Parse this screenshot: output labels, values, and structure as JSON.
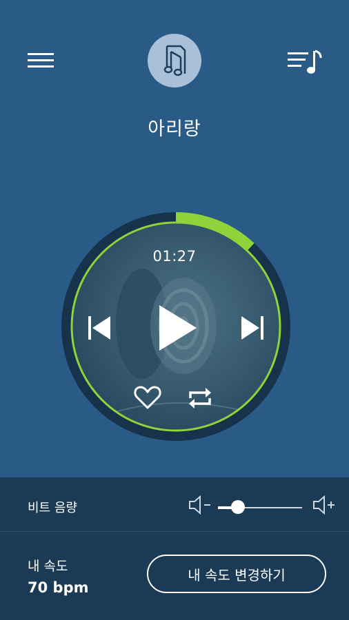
{
  "colors": {
    "background": "#2a5a86",
    "bottom_panel": "#1a3a55",
    "accent_green": "#8fd33a",
    "ring_dark": "#17324b"
  },
  "header": {
    "menu_icon": "hamburger-menu-icon",
    "album_icon": "music-file-icon",
    "queue_icon": "playlist-icon"
  },
  "song": {
    "title": "아리랑"
  },
  "player": {
    "elapsed": "01:27",
    "progress_fraction": 0.12,
    "icons": {
      "previous": "skip-previous-icon",
      "play": "play-icon",
      "next": "skip-next-icon",
      "favorite": "heart-icon",
      "repeat": "repeat-icon"
    }
  },
  "beat_volume": {
    "label": "비트 음량",
    "level_fraction": 0.24,
    "down_icon": "volume-down-icon",
    "up_icon": "volume-up-icon"
  },
  "speed": {
    "label": "내 속도",
    "value": "70 bpm",
    "change_button": "내 속도 변경하기"
  }
}
